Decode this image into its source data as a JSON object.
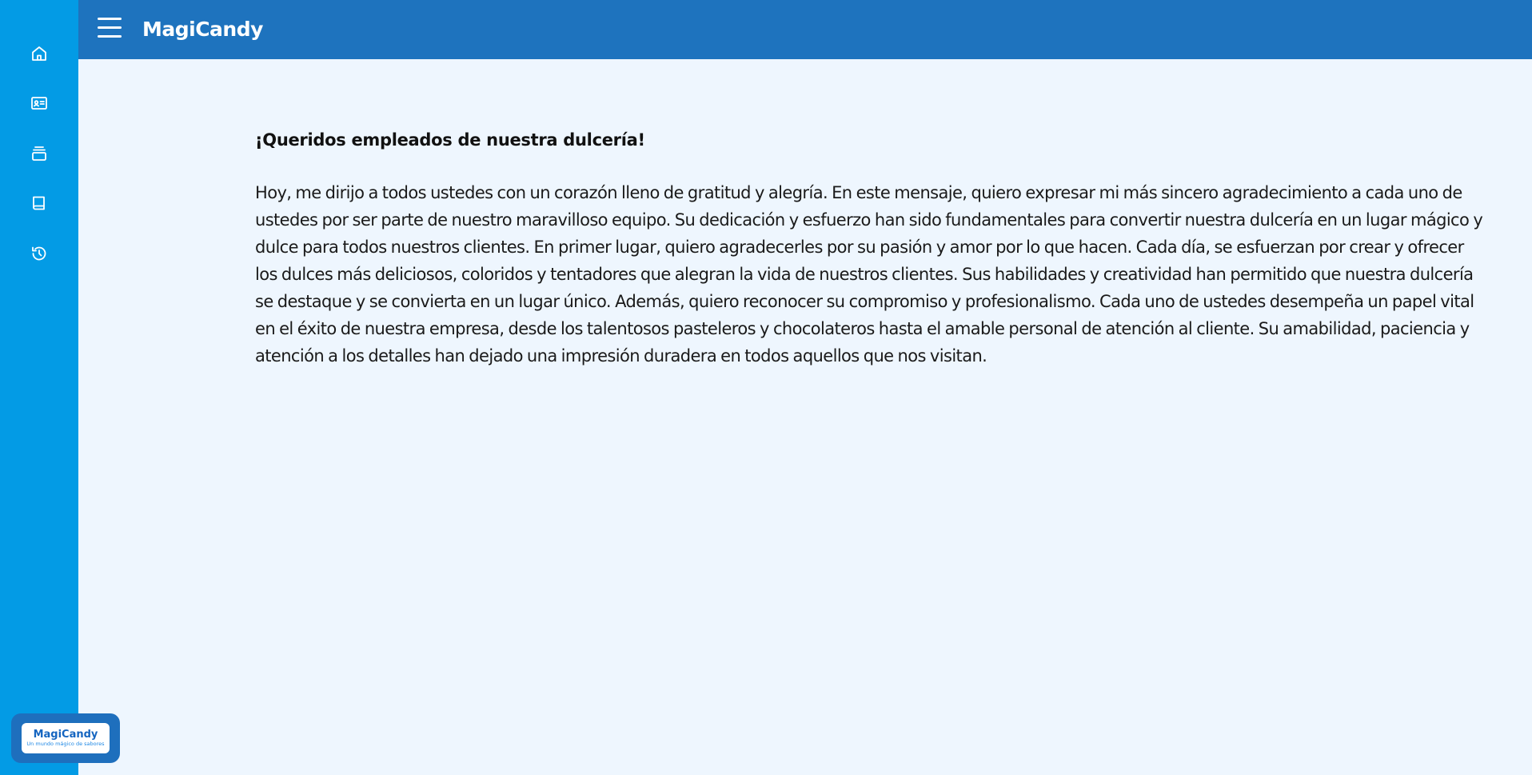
{
  "app": {
    "title": "MagiCandy"
  },
  "topbar": {
    "menu_icon": "hamburger-menu-icon"
  },
  "sidebar": {
    "items": [
      {
        "icon": "home-icon"
      },
      {
        "icon": "id-card-icon"
      },
      {
        "icon": "stack-icon"
      },
      {
        "icon": "book-icon"
      },
      {
        "icon": "history-icon"
      }
    ],
    "logo": {
      "brand": "MagiCandy",
      "tagline": "Un mundo mágico de sabores"
    }
  },
  "main": {
    "greeting": "¡Queridos empleados de nuestra dulcería!",
    "message": "Hoy, me dirijo a todos ustedes con un corazón lleno de gratitud y alegría. En este mensaje, quiero expresar mi más sincero agradecimiento a cada uno de ustedes por ser parte de nuestro maravilloso equipo. Su dedicación y esfuerzo han sido fundamentales para convertir nuestra dulcería en un lugar mágico y dulce para todos nuestros clientes. En primer lugar, quiero agradecerles por su pasión y amor por lo que hacen. Cada día, se esfuerzan por crear y ofrecer los dulces más deliciosos, coloridos y tentadores que alegran la vida de nuestros clientes. Sus habilidades y creatividad han permitido que nuestra dulcería se destaque y se convierta en un lugar único. Además, quiero reconocer su compromiso y profesionalismo. Cada uno de ustedes desempeña un papel vital en el éxito de nuestra empresa, desde los talentosos pasteleros y chocolateros hasta el amable personal de atención al cliente. Su amabilidad, paciencia y atención a los detalles han dejado una impresión duradera en todos aquellos que nos visitan."
  },
  "colors": {
    "sidebar": "#039be5",
    "topbar": "#1e73be",
    "background": "#eef6fe"
  }
}
